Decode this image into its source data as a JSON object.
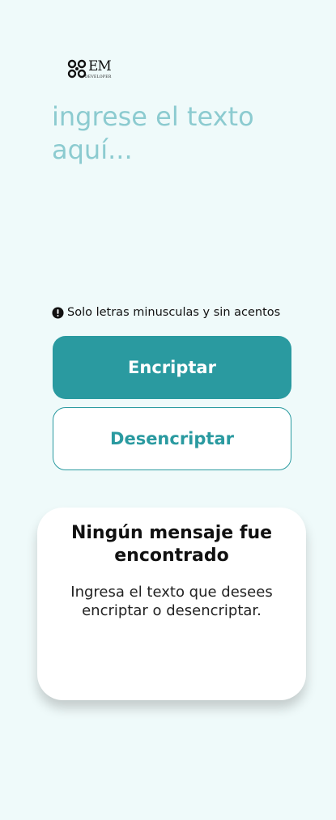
{
  "logo": {
    "name": "EM",
    "subtitle": "DEVELOPER",
    "icon": "em-developer-logo"
  },
  "input": {
    "placeholder": "ingrese el texto aquí...",
    "value": ""
  },
  "hint": {
    "icon": "exclamation-circle-icon",
    "text": "Solo letras minusculas y sin acentos"
  },
  "buttons": {
    "encrypt_label": "Encriptar",
    "decrypt_label": "Desencriptar"
  },
  "result": {
    "title": "Ningún mensaje fue encontrado",
    "description": "Ingresa el texto que desees encriptar o desencriptar."
  },
  "colors": {
    "background": "#effafa",
    "accent": "#2a9aa0",
    "placeholder": "#8ccbd0"
  }
}
